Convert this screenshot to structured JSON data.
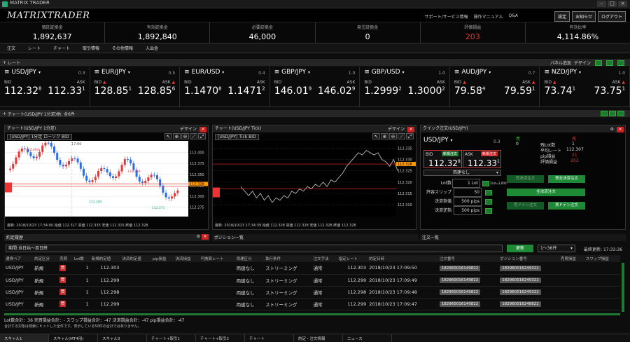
{
  "window": {
    "title": "MATRIX TRADER"
  },
  "header": {
    "logo": "MATRIXTRADER",
    "links": [
      "サポート/サービス情報",
      "操作マニュアル",
      "Q&A"
    ],
    "buttons": [
      "設定",
      "お知らせ",
      "ログアウト"
    ]
  },
  "summary": [
    {
      "label": "預託証拠金",
      "value": "1,892,637"
    },
    {
      "label": "有効証拠金",
      "value": "1,892,840"
    },
    {
      "label": "必要証拠金",
      "value": "46,000"
    },
    {
      "label": "発注証拠金",
      "value": "0"
    },
    {
      "label": "評価損益",
      "value": "203",
      "color": "#e33"
    },
    {
      "label": "有効比率",
      "value": "4,114.86%"
    }
  ],
  "menu": [
    "注文",
    "レート",
    "チャート",
    "取引情報",
    "その他情報",
    "入出金"
  ],
  "rate_panel": {
    "title": "レート",
    "controls": [
      "パネル追加",
      "デザイン"
    ]
  },
  "rates": [
    {
      "pair": "USD/JPY",
      "spread": "0.3",
      "bid": "112.32",
      "bid_sup": "8",
      "ask": "112.33",
      "ask_sup": "1"
    },
    {
      "pair": "EUR/JPY",
      "spread": "0.5",
      "bid": "128.85",
      "bid_sup": "1",
      "ask": "128.85",
      "ask_sup": "6"
    },
    {
      "pair": "EUR/USD",
      "spread": "0.4",
      "bid": "1.1470",
      "bid_sup": "8",
      "ask": "1.1471",
      "ask_sup": "2"
    },
    {
      "pair": "GBP/JPY",
      "spread": "1.0",
      "bid": "146.01",
      "bid_sup": "9",
      "ask": "146.02",
      "ask_sup": "9"
    },
    {
      "pair": "GBP/USD",
      "spread": "1.0",
      "bid": "1.2999",
      "bid_sup": "2",
      "ask": "1.3000",
      "ask_sup": "2"
    },
    {
      "pair": "AUD/JPY",
      "spread": "0.7",
      "bid": "79.58",
      "bid_sup": "4",
      "ask": "79.59",
      "ask_sup": "1"
    },
    {
      "pair": "NZD/JPY",
      "spread": "1.0",
      "bid": "73.74",
      "bid_sup": "1",
      "ask": "73.75",
      "ask_sup": "1"
    }
  ],
  "rate_labels": {
    "bid": "BID",
    "ask": "ASK"
  },
  "chart_section": {
    "title": "チャート(USD/JPY 1分足)他: 全6件"
  },
  "chart1": {
    "title": "チャート(USD/JPY 1分足)",
    "design": "デザイン",
    "select": "[USD/JPY] 1分足 ローソク BID",
    "footer": "最新: 2018/10/23 17:34:00 始値 112.317 高値 112.333 安値 112.315 終値 112.328",
    "yticks": [
      "112.400",
      "112.375",
      "112.350",
      "112.325",
      "112.300",
      "112.275"
    ],
    "time": "17:00",
    "marks": {
      "high": "112.404",
      "mid": "112.358",
      "low1": "112.285",
      "low2": "112.271",
      "cur": "112.328",
      "cur2": "112.320"
    }
  },
  "chart2": {
    "title": "チャート(USD/JPY Tick)",
    "design": "デザイン",
    "select": "[USD/JPY] Tick BID",
    "footer": "最新: 2018/10/23 17:34:39 始値 112.328 高値 112.328 安値 112.328 終値 112.328",
    "yticks": [
      "112.335",
      "112.330",
      "112.325",
      "112.320",
      "112.315",
      "112.310"
    ],
    "cur": "112.328"
  },
  "quick": {
    "title": "クイック注文(USD/JPY)",
    "pair": "USD/JPY",
    "spread": "0.3",
    "bid_label": "BID",
    "bid_tag": "新規注文",
    "bid": "112.32",
    "bid_sup": "8",
    "ask_label": "ASK",
    "ask_tag": "新規注文",
    "ask": "112.33",
    "ask_sup": "1",
    "mode": "両建なし",
    "lot_label": "Lot数",
    "lot": "1",
    "lot_unit": "Lot",
    "lot_note": "1Lot=1,000",
    "slip_label": "許容スリップ",
    "slip": "50",
    "limit_label": "決済指値",
    "limit": "500",
    "limit_unit": "pips",
    "stop_label": "決済逆指",
    "stop": "500",
    "stop_unit": "pips",
    "buy_col": "買",
    "sell_col": "売",
    "pos": "0",
    "pos_label": "残Lot数",
    "pos_sell": "1",
    "avg_label": "平均レート",
    "avg": "112.307",
    "pip_label": "pip損益",
    "pip": "21",
    "eval_label": "評価損益",
    "eval": "203",
    "btns": [
      "売決済注文",
      "買全決済注文",
      "全決済注文",
      "売ドテン注文",
      "買ドテン注文"
    ]
  },
  "tabs": {
    "orders": "約定履歴",
    "positions": "ポジション一覧",
    "contract": "注文一覧"
  },
  "filter": {
    "period": "期間:当日始〜翌日終",
    "update": "更新",
    "paging": "1〜36件",
    "last_update_label": "最終更新:",
    "last_update": "17:33:36"
  },
  "table": {
    "headers": [
      "通貨ペア",
      "約定区分",
      "売買",
      "Lot数",
      "新規約定値",
      "決済約定値",
      "pip損益",
      "決済損益",
      "円換算レート",
      "両建区分",
      "執行条件",
      "注文手法",
      "指定レート",
      "約定日時",
      "注文番号",
      "ポジション番号",
      "売買損益",
      "スワップ損益"
    ],
    "rows": [
      {
        "pair": "USD/JPY",
        "kind": "新規",
        "side": "買",
        "lot": "1",
        "open": "112.303",
        "cond": "両建なし",
        "exec": "ストリーミング",
        "method": "通常",
        "rate": "112.303",
        "date": "2018/10/23 17:09:50",
        "order": "182960016149822",
        "pos": "182960016249322"
      },
      {
        "pair": "USD/JPY",
        "kind": "新規",
        "side": "買",
        "lot": "1",
        "open": "112.299",
        "cond": "両建なし",
        "exec": "ストリーミング",
        "method": "通常",
        "rate": "112.299",
        "date": "2018/10/23 17:09:49",
        "order": "182960016149822",
        "pos": "182960016249322"
      },
      {
        "pair": "USD/JPY",
        "kind": "新規",
        "side": "買",
        "lot": "1",
        "open": "112.298",
        "cond": "両建なし",
        "exec": "ストリーミング",
        "method": "通常",
        "rate": "112.298",
        "date": "2018/10/23 17:09:48",
        "order": "182960016149822",
        "pos": "182960016249322"
      },
      {
        "pair": "USD/JPY",
        "kind": "新規",
        "side": "買",
        "lot": "1",
        "open": "112.299",
        "cond": "両建なし",
        "exec": "ストリーミング",
        "method": "通常",
        "rate": "112.299",
        "date": "2018/10/23 17:09:47",
        "order": "182960016149822",
        "pos": "182960016248822"
      }
    ]
  },
  "totals": {
    "line1": "Lot数合計：36  売買損益合計：-  スワップ損益合計：-47  決済損益合計：-47  pip損益合計：-47",
    "line2": "合計する対象は検索にヒットした全件です。表示している50件の合計ではありません。"
  },
  "bottom_tabs": [
    "スキャル1",
    "スキャル(MT4用)",
    "スキャル3",
    "チャート+取引1",
    "チャート+取引2",
    "チャート",
    "約定・注文情報",
    "ニュース"
  ],
  "colors": {
    "red": "#e33",
    "green": "#1e7a32"
  }
}
